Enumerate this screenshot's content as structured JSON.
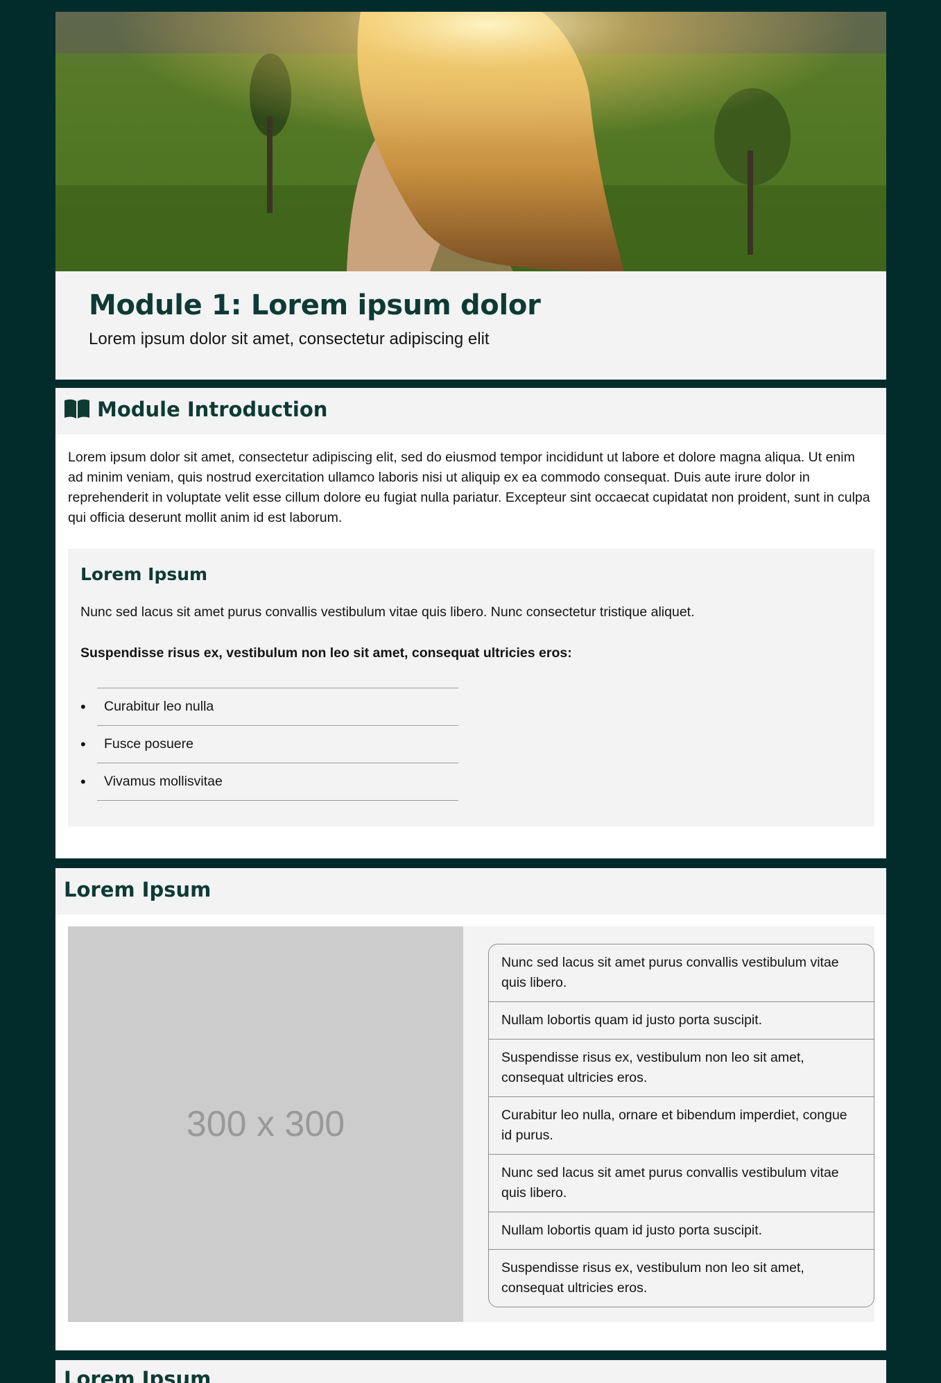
{
  "colors": {
    "background": "#022c2c",
    "heading": "#0e3a34",
    "panel": "#f3f3f3",
    "placeholder": "#cccccc"
  },
  "hero": {
    "image": "hero-photo"
  },
  "module": {
    "title": "Module 1: Lorem ipsum dolor",
    "subtitle": "Lorem ipsum dolor sit amet, consectetur adipiscing elit"
  },
  "intro_section": {
    "icon": "book-open-icon",
    "heading": "Module Introduction",
    "text": "Lorem ipsum dolor sit amet, consectetur adipiscing elit, sed do eiusmod tempor incididunt ut labore et dolore magna aliqua. Ut enim ad minim veniam, quis nostrud exercitation ullamco laboris nisi ut aliquip ex ea commodo consequat. Duis aute irure dolor in reprehenderit in voluptate velit esse cillum dolore eu fugiat nulla pariatur. Excepteur sint occaecat cupidatat non proident, sunt in culpa qui officia deserunt mollit anim id est laborum.",
    "card": {
      "heading": "Lorem Ipsum",
      "paragraph": "Nunc sed lacus sit amet purus convallis vestibulum vitae quis libero. Nunc consectetur tristique aliquet.",
      "bold_paragraph": "Suspendisse risus ex, vestibulum non leo sit amet, consequat ultricies eros:",
      "list": [
        "Curabitur leo nulla",
        "Fusce posuere",
        "Vivamus mollisvitae"
      ]
    }
  },
  "media_section": {
    "heading": "Lorem Ipsum",
    "placeholder_text": "300 x 300",
    "items": [
      "Nunc sed lacus sit amet purus convallis vestibulum vitae quis libero.",
      "Nullam lobortis quam id justo porta suscipit.",
      "Suspendisse risus ex, vestibulum non leo sit amet, consequat ultricies eros.",
      "Curabitur leo nulla, ornare et bibendum imperdiet, congue id purus.",
      "Nunc sed lacus sit amet purus convallis vestibulum vitae quis libero.",
      "Nullam lobortis quam id justo porta suscipit.",
      "Suspendisse risus ex, vestibulum non leo sit amet, consequat ultricies eros."
    ]
  },
  "next_section": {
    "heading": "Lorem Ipsum"
  }
}
